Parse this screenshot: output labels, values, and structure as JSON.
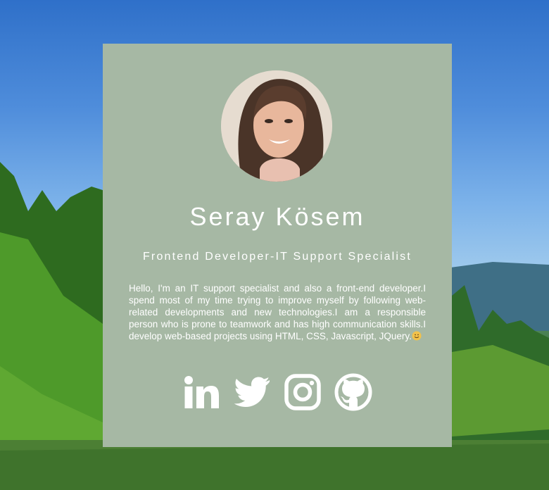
{
  "profile": {
    "name": "Seray Kösem",
    "role": "Frontend Developer-IT Support Specialist",
    "bio": "Hello, I'm an IT support specialist and also a front-end developer.I spend most of my time trying to improve myself by following web-related developments and new technologies.I am a responsible person who is prone to teamwork and has high communication skills.I develop web-based projects using HTML, CSS, Javascript, JQuery."
  },
  "socials": [
    {
      "icon": "linkedin-icon"
    },
    {
      "icon": "twitter-icon"
    },
    {
      "icon": "instagram-icon"
    },
    {
      "icon": "github-icon"
    }
  ],
  "colors": {
    "card_background": "#a6b8a4",
    "text": "#ffffff"
  }
}
